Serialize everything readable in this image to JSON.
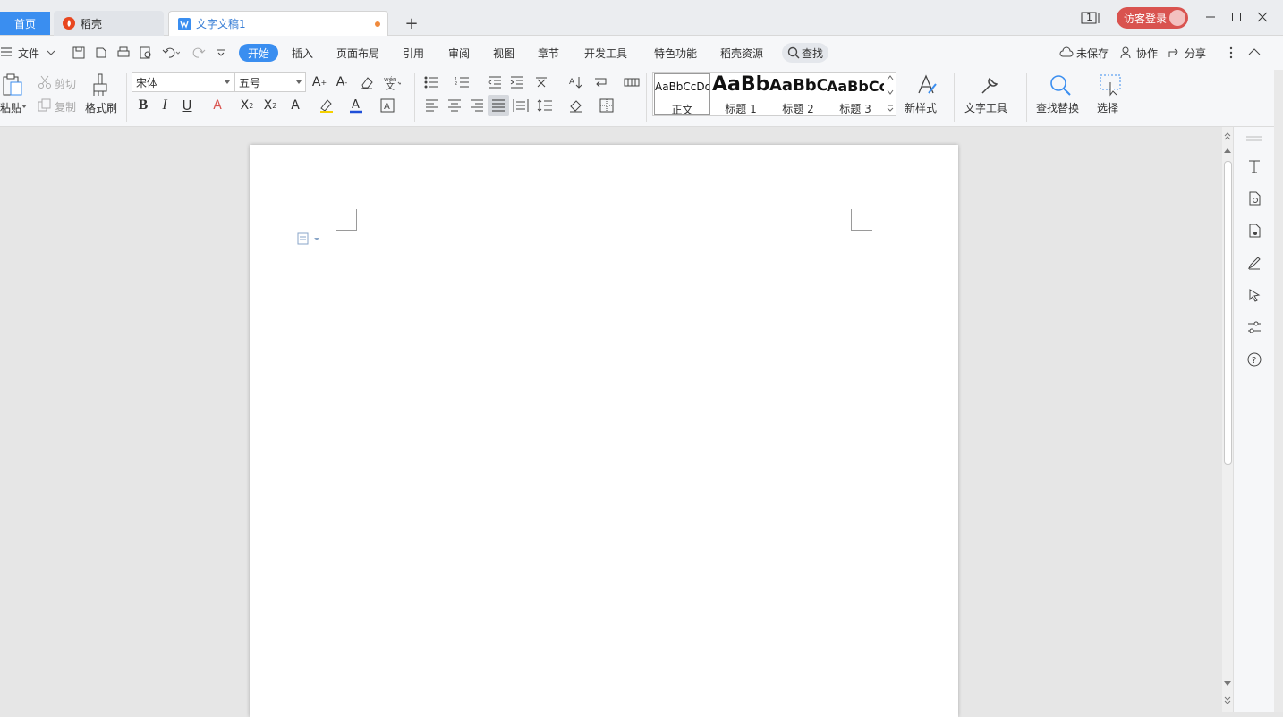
{
  "tabs": {
    "home": "首页",
    "daoke": "稻壳",
    "document": "文字文稿1"
  },
  "titlebar": {
    "page_counter": "1",
    "visitor_login": "访客登录"
  },
  "menu": {
    "file": "文件",
    "items": [
      "开始",
      "插入",
      "页面布局",
      "引用",
      "审阅",
      "视图",
      "章节",
      "开发工具",
      "特色功能",
      "稻壳资源"
    ],
    "search": "查找",
    "unsaved": "未保存",
    "collaborate": "协作",
    "share": "分享"
  },
  "ribbon": {
    "paste": "粘贴",
    "cut": "剪切",
    "copy": "复制",
    "format_painter": "格式刷",
    "font_name": "宋体",
    "font_size": "五号",
    "styles": [
      {
        "preview": "AaBbCcDd",
        "name": "正文"
      },
      {
        "preview": "AaBb",
        "name": "标题 1"
      },
      {
        "preview": "AaBbC",
        "name": "标题 2"
      },
      {
        "preview": "AaBbCc",
        "name": "标题 3"
      }
    ],
    "new_style": "新样式",
    "text_tools": "文字工具",
    "find_replace": "查找替换",
    "select": "选择"
  },
  "colors": {
    "accent": "#3a8ef0",
    "login": "#d9534f",
    "unsaved_dot": "#f08a3c",
    "font_color": "#1f4fd8"
  }
}
